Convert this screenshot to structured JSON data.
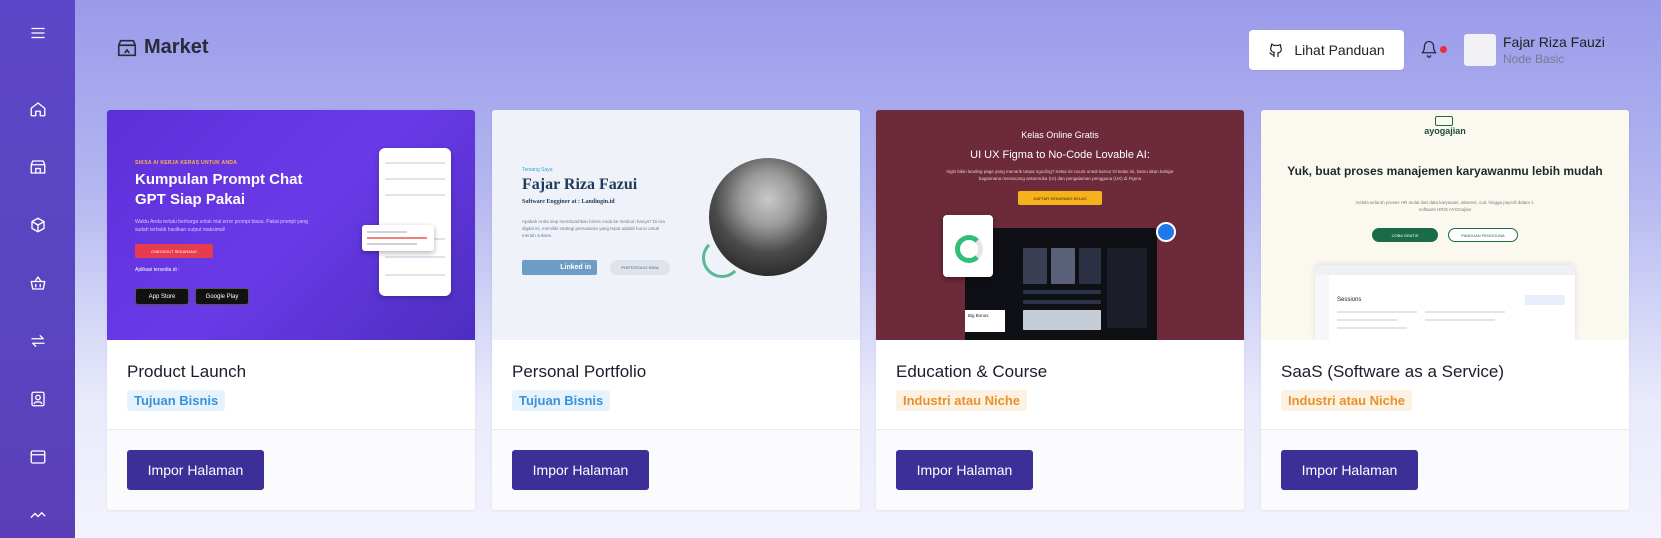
{
  "header": {
    "title": "Market",
    "guide_label": "Lihat Panduan"
  },
  "user": {
    "name": "Fajar Riza Fauzi",
    "plan": "Node Basic"
  },
  "sidebar": {
    "items": [
      {
        "icon": "menu-icon"
      },
      {
        "icon": "home-icon"
      },
      {
        "icon": "store-icon"
      },
      {
        "icon": "box-icon"
      },
      {
        "icon": "basket-icon"
      },
      {
        "icon": "transfer-icon"
      },
      {
        "icon": "contact-icon"
      },
      {
        "icon": "browser-icon"
      },
      {
        "icon": "activity-icon"
      }
    ]
  },
  "cards": [
    {
      "title": "Product Launch",
      "badge": "Tujuan Bisnis",
      "button": "Impor Halaman",
      "preview": {
        "tag": "SIKSA AI KERJA KERAS UNTUK ANDA",
        "headline": "Kumpulan Prompt Chat GPT Siap Pakai",
        "body": "Waktu Anda terlalu berharga untuk trial error prompt biasa. Pakai prompt yang sudah terbukti hasilkan output maksimal!",
        "cta": "CHECKOUT SEKARANG",
        "available": "Aplikasi tersedia di :",
        "store1": "App Store",
        "store2": "Google Play"
      }
    },
    {
      "title": "Personal Portfolio",
      "badge": "Tujuan Bisnis",
      "button": "Impor Halaman",
      "preview": {
        "tag": "Tentang Saya",
        "headline": "Fajar Riza Fazui",
        "sub": "Software Engginer at : Landingin.id",
        "body": "Apakah Anda siap membutuhkan bisnis Anda ke medium hanya? Di era digital ini, memiliki strategi pemasaran yang tepat adalah kunci untuk meraih sukses.",
        "linkedin": "Linked in",
        "portfolio": "PORTOFOLIO SAYA"
      }
    },
    {
      "title": "Education & Course",
      "badge": "Industri atau Niche",
      "button": "Impor Halaman",
      "preview": {
        "tag": "Kelas Online Gratis",
        "headline": "UI UX Figma to No-Code Lovable AI:",
        "body": "Ingin bikin landing page yang menarik tanpa ngoding? Kelas ini cocok untuk kamu! Di kelas ini, kamu akan belajar bagaimana merancang antarmuka (UI) dan pengalaman pengguna (UX) di Figma",
        "cta": "DAFTAR SEKARANG KELAS",
        "bonus": "Big Bonus"
      }
    },
    {
      "title": "SaaS (Software as a Service)",
      "badge": "Industri atau Niche",
      "button": "Impor Halaman",
      "preview": {
        "logo": "ayogajian",
        "headline": "Yuk, buat proses manajemen karyawanmu lebih mudah",
        "body": "Kelola seluruh proses HR mulai dari data karyawan, absensi, cuti, hingga payroll dalam 1 software HRIS AYOGajian",
        "btn1": "COBA GRATIS",
        "btn2": "PANDUAN PENGGUNA",
        "app_title": "Sessions"
      }
    }
  ],
  "colors": {
    "sidebar": "#5c47c8",
    "primary_button": "#3c2f97",
    "badge_bisnis": "#3b91d6",
    "badge_niche": "#e7922b",
    "notification_dot": "#e5313a"
  }
}
